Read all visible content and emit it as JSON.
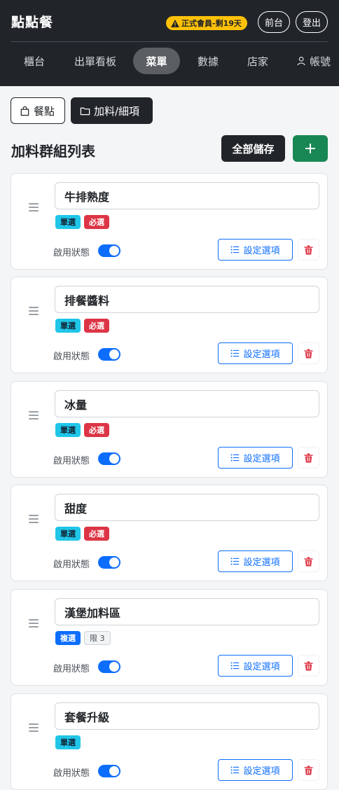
{
  "header": {
    "brand": "點點餐",
    "member_badge": "正式會員-剩19天",
    "front_label": "前台",
    "logout_label": "登出"
  },
  "nav": [
    {
      "label": "櫃台",
      "active": false
    },
    {
      "label": "出單看板",
      "active": false
    },
    {
      "label": "菜單",
      "active": true
    },
    {
      "label": "數據",
      "active": false
    },
    {
      "label": "店家",
      "active": false
    },
    {
      "label": "帳號",
      "active": false
    }
  ],
  "toolbar": {
    "meal_label": "餐點",
    "addon_label": "加料/細項"
  },
  "section": {
    "title": "加料群組列表",
    "save_all_label": "全部儲存",
    "add_label": "+"
  },
  "card_common": {
    "status_label": "啟用狀態",
    "options_label": "設定選項"
  },
  "groups": [
    {
      "name": "牛排熟度",
      "type": "單選",
      "required": "必選",
      "limit": null,
      "enabled": true
    },
    {
      "name": "排餐醬料",
      "type": "單選",
      "required": "必選",
      "limit": null,
      "enabled": true
    },
    {
      "name": "冰量",
      "type": "單選",
      "required": "必選",
      "limit": null,
      "enabled": true
    },
    {
      "name": "甜度",
      "type": "單選",
      "required": "必選",
      "limit": null,
      "enabled": true
    },
    {
      "name": "漢堡加料區",
      "type": "複選",
      "required": null,
      "limit": "限 3",
      "enabled": true
    },
    {
      "name": "套餐升級",
      "type": "單選",
      "required": null,
      "limit": null,
      "enabled": true
    }
  ],
  "colors": {
    "header_bg": "#212529",
    "badge_warning": "#ffc107",
    "single_badge": "#20c6e8",
    "multi_badge": "#0d6efd",
    "required_badge": "#dc3545",
    "add_button": "#198754",
    "switch_on": "#0d6efd"
  }
}
